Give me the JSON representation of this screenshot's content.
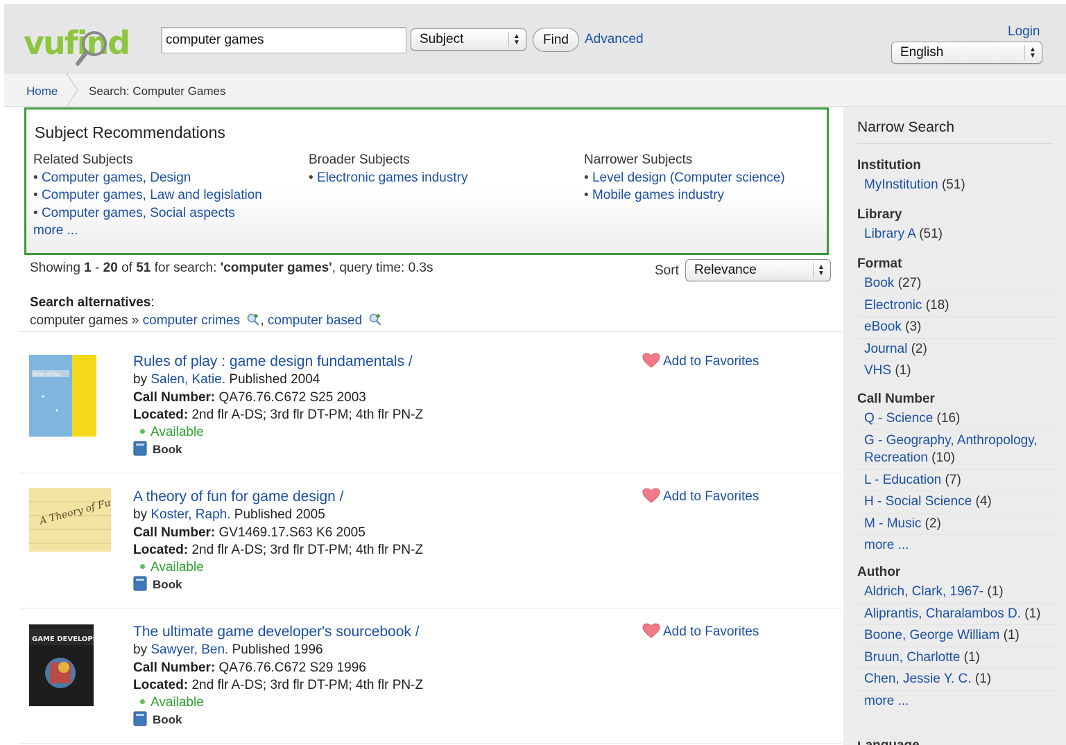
{
  "header": {
    "search_value": "computer games",
    "search_type": "Subject",
    "find_label": "Find",
    "advanced_label": "Advanced",
    "login_label": "Login",
    "language": "English",
    "logo_text": "vufind"
  },
  "breadcrumb": {
    "home": "Home",
    "current": "Search: Computer Games"
  },
  "recommendations": {
    "title": "Subject Recommendations",
    "related": {
      "heading": "Related Subjects",
      "items": [
        "Computer games, Design",
        "Computer games, Law and legislation",
        "Computer games, Social aspects"
      ],
      "more": "more ..."
    },
    "broader": {
      "heading": "Broader Subjects",
      "items": [
        "Electronic games industry"
      ]
    },
    "narrower": {
      "heading": "Narrower Subjects",
      "items": [
        "Level design (Computer science)",
        "Mobile games industry"
      ]
    }
  },
  "results_summary": {
    "prefix": "Showing",
    "start": "1",
    "dash": "-",
    "end": "20",
    "of": "of",
    "total": "51",
    "for_search": "for search:",
    "query": "'computer games'",
    "query_time": ", query time: 0.3s",
    "sort_label": "Sort",
    "sort_value": "Relevance"
  },
  "alternatives": {
    "heading": "Search alternatives",
    "colon": ":",
    "base": "computer games »",
    "items": [
      "computer crimes",
      "computer based"
    ],
    "comma": ","
  },
  "labels": {
    "by": "by",
    "call_number": "Call Number:",
    "located": "Located:",
    "add_favorites": "Add to Favorites"
  },
  "results": [
    {
      "title": "Rules of play : game design fundamentals /",
      "author": "Salen, Katie.",
      "published": "Published 2004",
      "call_number": "QA76.76.C672 S25 2003",
      "located": "2nd flr A-DS; 3rd flr DT-PM; 4th flr PN-Z",
      "status": "Available",
      "format": "Book",
      "cover_text": "Rules of Play"
    },
    {
      "title": "A theory of fun for game design /",
      "author": "Koster, Raph.",
      "published": "Published 2005",
      "call_number": "GV1469.17.S63 K6 2005",
      "located": "2nd flr A-DS; 3rd flr DT-PM; 4th flr PN-Z",
      "status": "Available",
      "format": "Book",
      "cover_text": "A Theory of Fun"
    },
    {
      "title": "The ultimate game developer's sourcebook /",
      "author": "Sawyer, Ben.",
      "published": "Published 1996",
      "call_number": "QA76.76.C672 S29 1996",
      "located": "2nd flr A-DS; 3rd flr DT-PM; 4th flr PN-Z",
      "status": "Available",
      "format": "Book",
      "cover_text": "GAME DEVELOPER'S"
    }
  ],
  "sidebar": {
    "title": "Narrow Search",
    "facets": [
      {
        "heading": "Institution",
        "items": [
          {
            "label": "MyInstitution",
            "count": "(51)"
          }
        ]
      },
      {
        "heading": "Library",
        "items": [
          {
            "label": "Library A",
            "count": "(51)"
          }
        ]
      },
      {
        "heading": "Format",
        "items": [
          {
            "label": "Book",
            "count": "(27)"
          },
          {
            "label": "Electronic",
            "count": "(18)"
          },
          {
            "label": "eBook",
            "count": "(3)"
          },
          {
            "label": "Journal",
            "count": "(2)"
          },
          {
            "label": "VHS",
            "count": "(1)"
          }
        ]
      },
      {
        "heading": "Call Number",
        "items": [
          {
            "label": "Q - Science",
            "count": "(16)"
          },
          {
            "label": "G - Geography, Anthropology, Recreation",
            "count": "(10)"
          },
          {
            "label": "L - Education",
            "count": "(7)"
          },
          {
            "label": "H - Social Science",
            "count": "(4)"
          },
          {
            "label": "M - Music",
            "count": "(2)"
          }
        ],
        "more": "more ..."
      },
      {
        "heading": "Author",
        "items": [
          {
            "label": "Aldrich, Clark, 1967-",
            "count": "(1)"
          },
          {
            "label": "Aliprantis, Charalambos D.",
            "count": "(1)"
          },
          {
            "label": "Boone, George William",
            "count": "(1)"
          },
          {
            "label": "Bruun, Charlotte",
            "count": "(1)"
          },
          {
            "label": "Chen, Jessie Y. C.",
            "count": "(1)"
          }
        ],
        "more": "more ..."
      }
    ],
    "next_heading": "Language"
  }
}
